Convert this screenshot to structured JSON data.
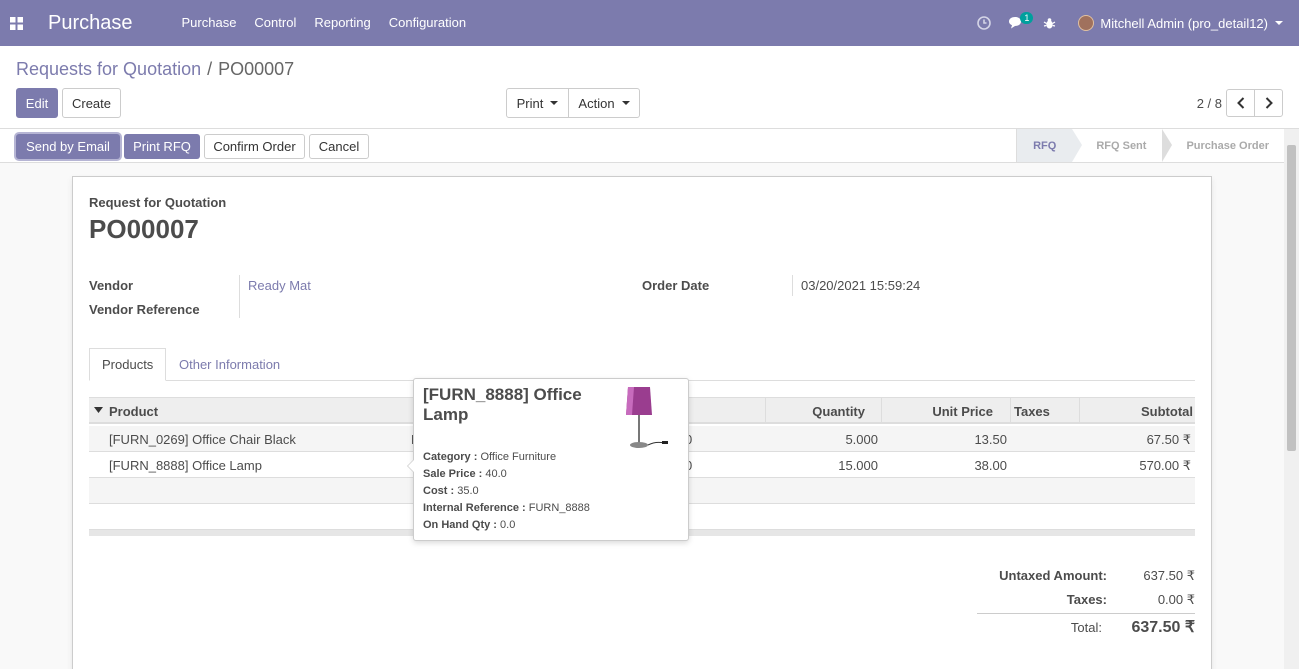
{
  "navbar": {
    "app_name": "Purchase",
    "menu": [
      "Purchase",
      "Control",
      "Reporting",
      "Configuration"
    ],
    "messages_count": "1",
    "user": "Mitchell Admin (pro_detail12)",
    "color": "#7c7bad"
  },
  "breadcrumb": {
    "parent": "Requests for Quotation",
    "sep": "/",
    "current": "PO00007"
  },
  "buttons": {
    "edit": "Edit",
    "create": "Create",
    "print": "Print",
    "action": "Action"
  },
  "pager": {
    "value": "2 / 8"
  },
  "statusbar": {
    "send_email": "Send by Email",
    "print_rfq": "Print RFQ",
    "confirm": "Confirm Order",
    "cancel": "Cancel",
    "stages": [
      "RFQ",
      "RFQ Sent",
      "Purchase Order"
    ],
    "active_stage": "RFQ"
  },
  "form": {
    "doc_type": "Request for Quotation",
    "name": "PO00007",
    "vendor_label": "Vendor",
    "vendor": "Ready Mat",
    "vendor_ref_label": "Vendor Reference",
    "vendor_ref": "",
    "order_date_label": "Order Date",
    "order_date": "03/20/2021 15:59:24"
  },
  "tabs": {
    "products": "Products",
    "other": "Other Information"
  },
  "table": {
    "headers": {
      "product": "Product",
      "quantity": "Quantity",
      "unit_price": "Unit Price",
      "taxes": "Taxes",
      "subtotal": "Subtotal"
    },
    "rows": [
      {
        "product": "[FURN_0269] Office Chair Black",
        "desc_fragment": "M",
        "date_fragment": "0",
        "quantity": "5.000",
        "unit_price": "13.50",
        "taxes": "",
        "subtotal": "67.50 ₹"
      },
      {
        "product": "[FURN_8888] Office Lamp",
        "desc_fragment": "",
        "date_fragment": "0",
        "quantity": "15.000",
        "unit_price": "38.00",
        "taxes": "",
        "subtotal": "570.00 ₹"
      }
    ]
  },
  "totals": {
    "untaxed_label": "Untaxed Amount:",
    "untaxed": "637.50 ₹",
    "taxes_label": "Taxes:",
    "taxes": "0.00 ₹",
    "total_label": "Total:",
    "total": "637.50 ₹"
  },
  "tooltip": {
    "title": "[FURN_8888] Office Lamp",
    "category_label": "Category :",
    "category": "Office Furniture",
    "sale_price_label": "Sale Price :",
    "sale_price": "40.0",
    "cost_label": "Cost :",
    "cost": "35.0",
    "internal_ref_label": "Internal Reference :",
    "internal_ref": "FURN_8888",
    "on_hand_label": "On Hand Qty :",
    "on_hand": "0.0"
  }
}
